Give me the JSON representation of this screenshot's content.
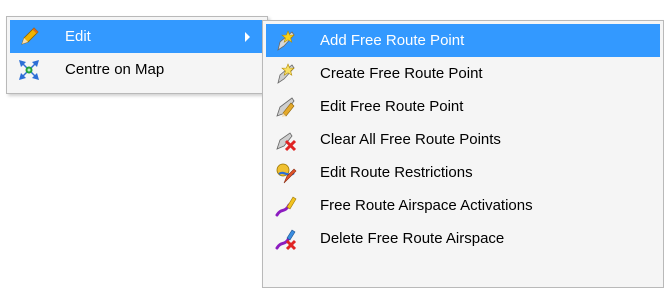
{
  "main_menu": {
    "items": [
      {
        "label": "Edit",
        "icon": "pencil-icon",
        "selected": true,
        "has_submenu": true
      },
      {
        "label": "Centre on Map",
        "icon": "centre-on-map-icon"
      }
    ]
  },
  "submenu": {
    "items": [
      {
        "label": "Add Free Route Point",
        "icon": "add-point-star-icon",
        "selected": true
      },
      {
        "label": "Create Free Route Point",
        "icon": "create-point-star-icon"
      },
      {
        "label": "Edit Free Route Point",
        "icon": "edit-point-pencil-icon"
      },
      {
        "label": "Clear All Free Route Points",
        "icon": "clear-points-x-icon"
      },
      {
        "label": "Edit Route Restrictions",
        "icon": "route-restrictions-icon"
      },
      {
        "label": "Free Route Airspace Activations",
        "icon": "airspace-activation-icon"
      },
      {
        "label": "Delete Free Route Airspace",
        "icon": "delete-airspace-icon"
      }
    ]
  },
  "colors": {
    "highlight": "#3399ff",
    "menu_background": "#f5f5f5",
    "menu_border": "#b9b9b9"
  }
}
